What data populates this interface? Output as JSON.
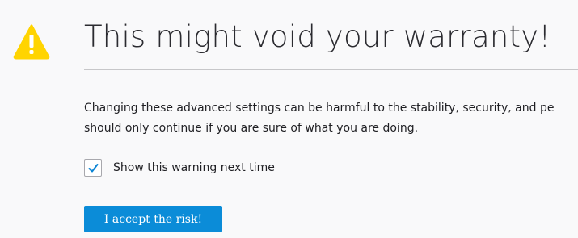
{
  "warning_icon": "warning-triangle-icon",
  "title": "This might void your warranty!",
  "message": {
    "line1": "Changing these advanced settings can be harmful to the stability, security, and pe",
    "line2": "should only continue if you are sure of what you are doing."
  },
  "checkbox": {
    "label": "Show this warning next time",
    "checked": true,
    "check_icon": "checkmark-icon"
  },
  "accept_button": {
    "label": "I accept the risk!"
  },
  "colors": {
    "warning": "#ffd400",
    "accent": "#0b8cd8",
    "checkmark": "#0a84d4",
    "background": "#f9f9fa"
  }
}
